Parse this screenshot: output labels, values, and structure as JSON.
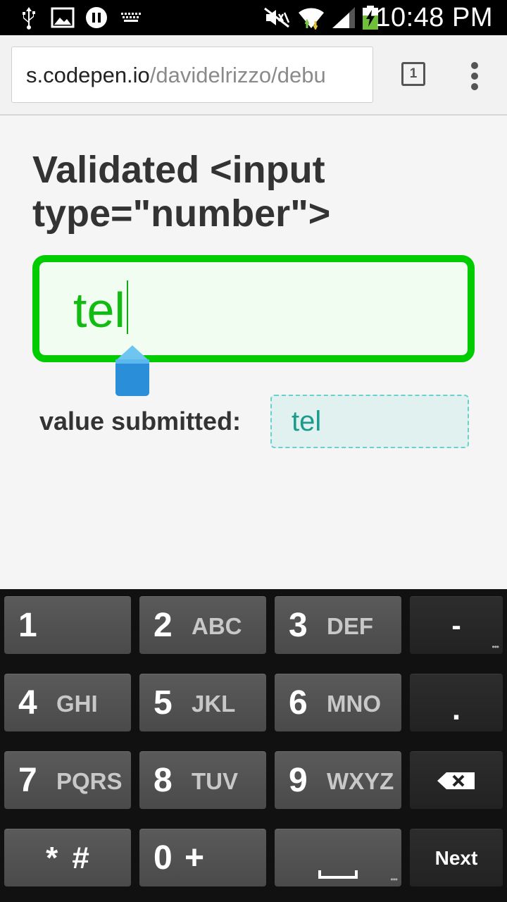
{
  "status_bar": {
    "time": "10:48 PM",
    "icons": [
      "usb-icon",
      "image-icon",
      "media-pause-icon",
      "keyboard-icon",
      "mute-icon",
      "wifi-icon",
      "signal-icon",
      "battery-charging-icon"
    ]
  },
  "browser": {
    "url_host": "s.codepen.io",
    "url_path": "/davidelrizzo/debu",
    "tab_count": "1"
  },
  "page": {
    "heading": "Validated <input type=\"number\">",
    "input_value": "tel",
    "submitted_label": "value submitted:",
    "submitted_value": "tel"
  },
  "keyboard": {
    "keys": [
      {
        "digit": "1",
        "letters": ""
      },
      {
        "digit": "2",
        "letters": "ABC"
      },
      {
        "digit": "3",
        "letters": "DEF"
      },
      {
        "symbol": "-"
      },
      {
        "digit": "4",
        "letters": "GHI"
      },
      {
        "digit": "5",
        "letters": "JKL"
      },
      {
        "digit": "6",
        "letters": "MNO"
      },
      {
        "symbol": "."
      },
      {
        "digit": "7",
        "letters": "PQRS"
      },
      {
        "digit": "8",
        "letters": "TUV"
      },
      {
        "digit": "9",
        "letters": "WXYZ"
      },
      {
        "symbol": "backspace"
      },
      {
        "label": "* #"
      },
      {
        "label": "0 +"
      },
      {
        "symbol": "space"
      },
      {
        "label": "Next"
      }
    ]
  },
  "colors": {
    "input_border": "#00cc00",
    "input_text": "#11bb11",
    "submitted_text": "#1a9b8e",
    "cursor_handle": "#2a8fd8"
  }
}
